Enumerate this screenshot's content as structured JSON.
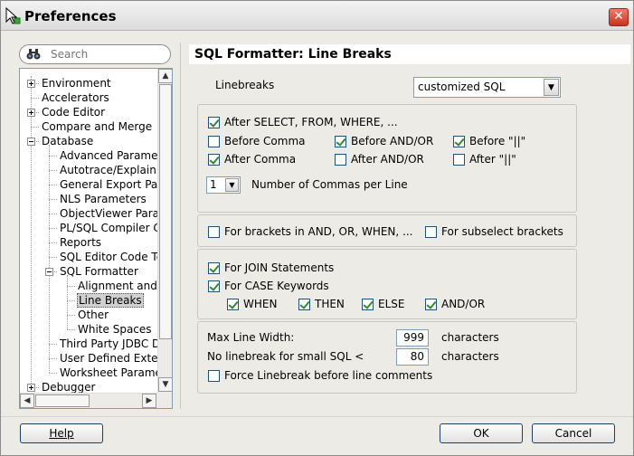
{
  "window": {
    "title": "Preferences",
    "close": "✕"
  },
  "search": {
    "placeholder": "Search"
  },
  "tree": [
    {
      "label": "Environment",
      "level": 0,
      "toggle": "plus"
    },
    {
      "label": "Accelerators",
      "level": 0,
      "toggle": "none"
    },
    {
      "label": "Code Editor",
      "level": 0,
      "toggle": "plus"
    },
    {
      "label": "Compare and Merge",
      "level": 0,
      "toggle": "none"
    },
    {
      "label": "Database",
      "level": 0,
      "toggle": "minus"
    },
    {
      "label": "Advanced Paramet",
      "level": 1,
      "toggle": "none"
    },
    {
      "label": "Autotrace/Explain F",
      "level": 1,
      "toggle": "none"
    },
    {
      "label": "General Export Par",
      "level": 1,
      "toggle": "none"
    },
    {
      "label": "NLS Parameters",
      "level": 1,
      "toggle": "none"
    },
    {
      "label": "ObjectViewer Parar",
      "level": 1,
      "toggle": "none"
    },
    {
      "label": "PL/SQL Compiler C",
      "level": 1,
      "toggle": "none"
    },
    {
      "label": "Reports",
      "level": 1,
      "toggle": "none"
    },
    {
      "label": "SQL Editor Code Te",
      "level": 1,
      "toggle": "none"
    },
    {
      "label": "SQL Formatter",
      "level": 1,
      "toggle": "minus"
    },
    {
      "label": "Alignment and I",
      "level": 2,
      "toggle": "none"
    },
    {
      "label": "Line Breaks",
      "level": 2,
      "toggle": "none",
      "selected": true
    },
    {
      "label": "Other",
      "level": 2,
      "toggle": "none"
    },
    {
      "label": "White Spaces",
      "level": 2,
      "toggle": "none"
    },
    {
      "label": "Third Party JDBC D",
      "level": 1,
      "toggle": "none"
    },
    {
      "label": "User Defined Exten",
      "level": 1,
      "toggle": "none"
    },
    {
      "label": "Worksheet Paramet",
      "level": 1,
      "toggle": "none"
    },
    {
      "label": "Debugger",
      "level": 0,
      "toggle": "plus"
    }
  ],
  "panel": {
    "title": "SQL Formatter: Line Breaks",
    "linebreaks_label": "Linebreaks",
    "linebreaks_value": "customized SQL",
    "group1": {
      "after_select": {
        "label": "After SELECT, FROM, WHERE, ...",
        "checked": true
      },
      "before_comma": {
        "label": "Before Comma",
        "checked": false
      },
      "before_andor": {
        "label": "Before  AND/OR",
        "checked": true
      },
      "before_concat": {
        "label": "Before  \"||\"",
        "checked": true
      },
      "after_comma": {
        "label": "After Comma",
        "checked": true
      },
      "after_andor": {
        "label": "After AND/OR",
        "checked": false
      },
      "after_concat": {
        "label": "After  \"||\"",
        "checked": false
      },
      "commas_value": "1",
      "commas_label": "Number of Commas per Line"
    },
    "group2": {
      "brackets": {
        "label": "For brackets in AND, OR, WHEN, ...",
        "checked": false
      },
      "subselect": {
        "label": "For subselect brackets",
        "checked": false
      }
    },
    "group3": {
      "join": {
        "label": "For JOIN Statements",
        "checked": true
      },
      "case": {
        "label": "For CASE Keywords",
        "checked": true
      },
      "when": {
        "label": "WHEN",
        "checked": true
      },
      "then": {
        "label": "THEN",
        "checked": true
      },
      "else": {
        "label": "ELSE",
        "checked": true
      },
      "andor": {
        "label": "AND/OR",
        "checked": true
      }
    },
    "group4": {
      "max_width_label": "Max Line Width:",
      "max_width_value": "999",
      "max_width_unit": "characters",
      "small_sql_label": "No linebreak for small SQL <",
      "small_sql_value": "80",
      "small_sql_unit": "characters",
      "force": {
        "label": "Force Linebreak before line comments",
        "checked": false
      }
    }
  },
  "buttons": {
    "help": "Help",
    "ok": "OK",
    "cancel": "Cancel"
  }
}
